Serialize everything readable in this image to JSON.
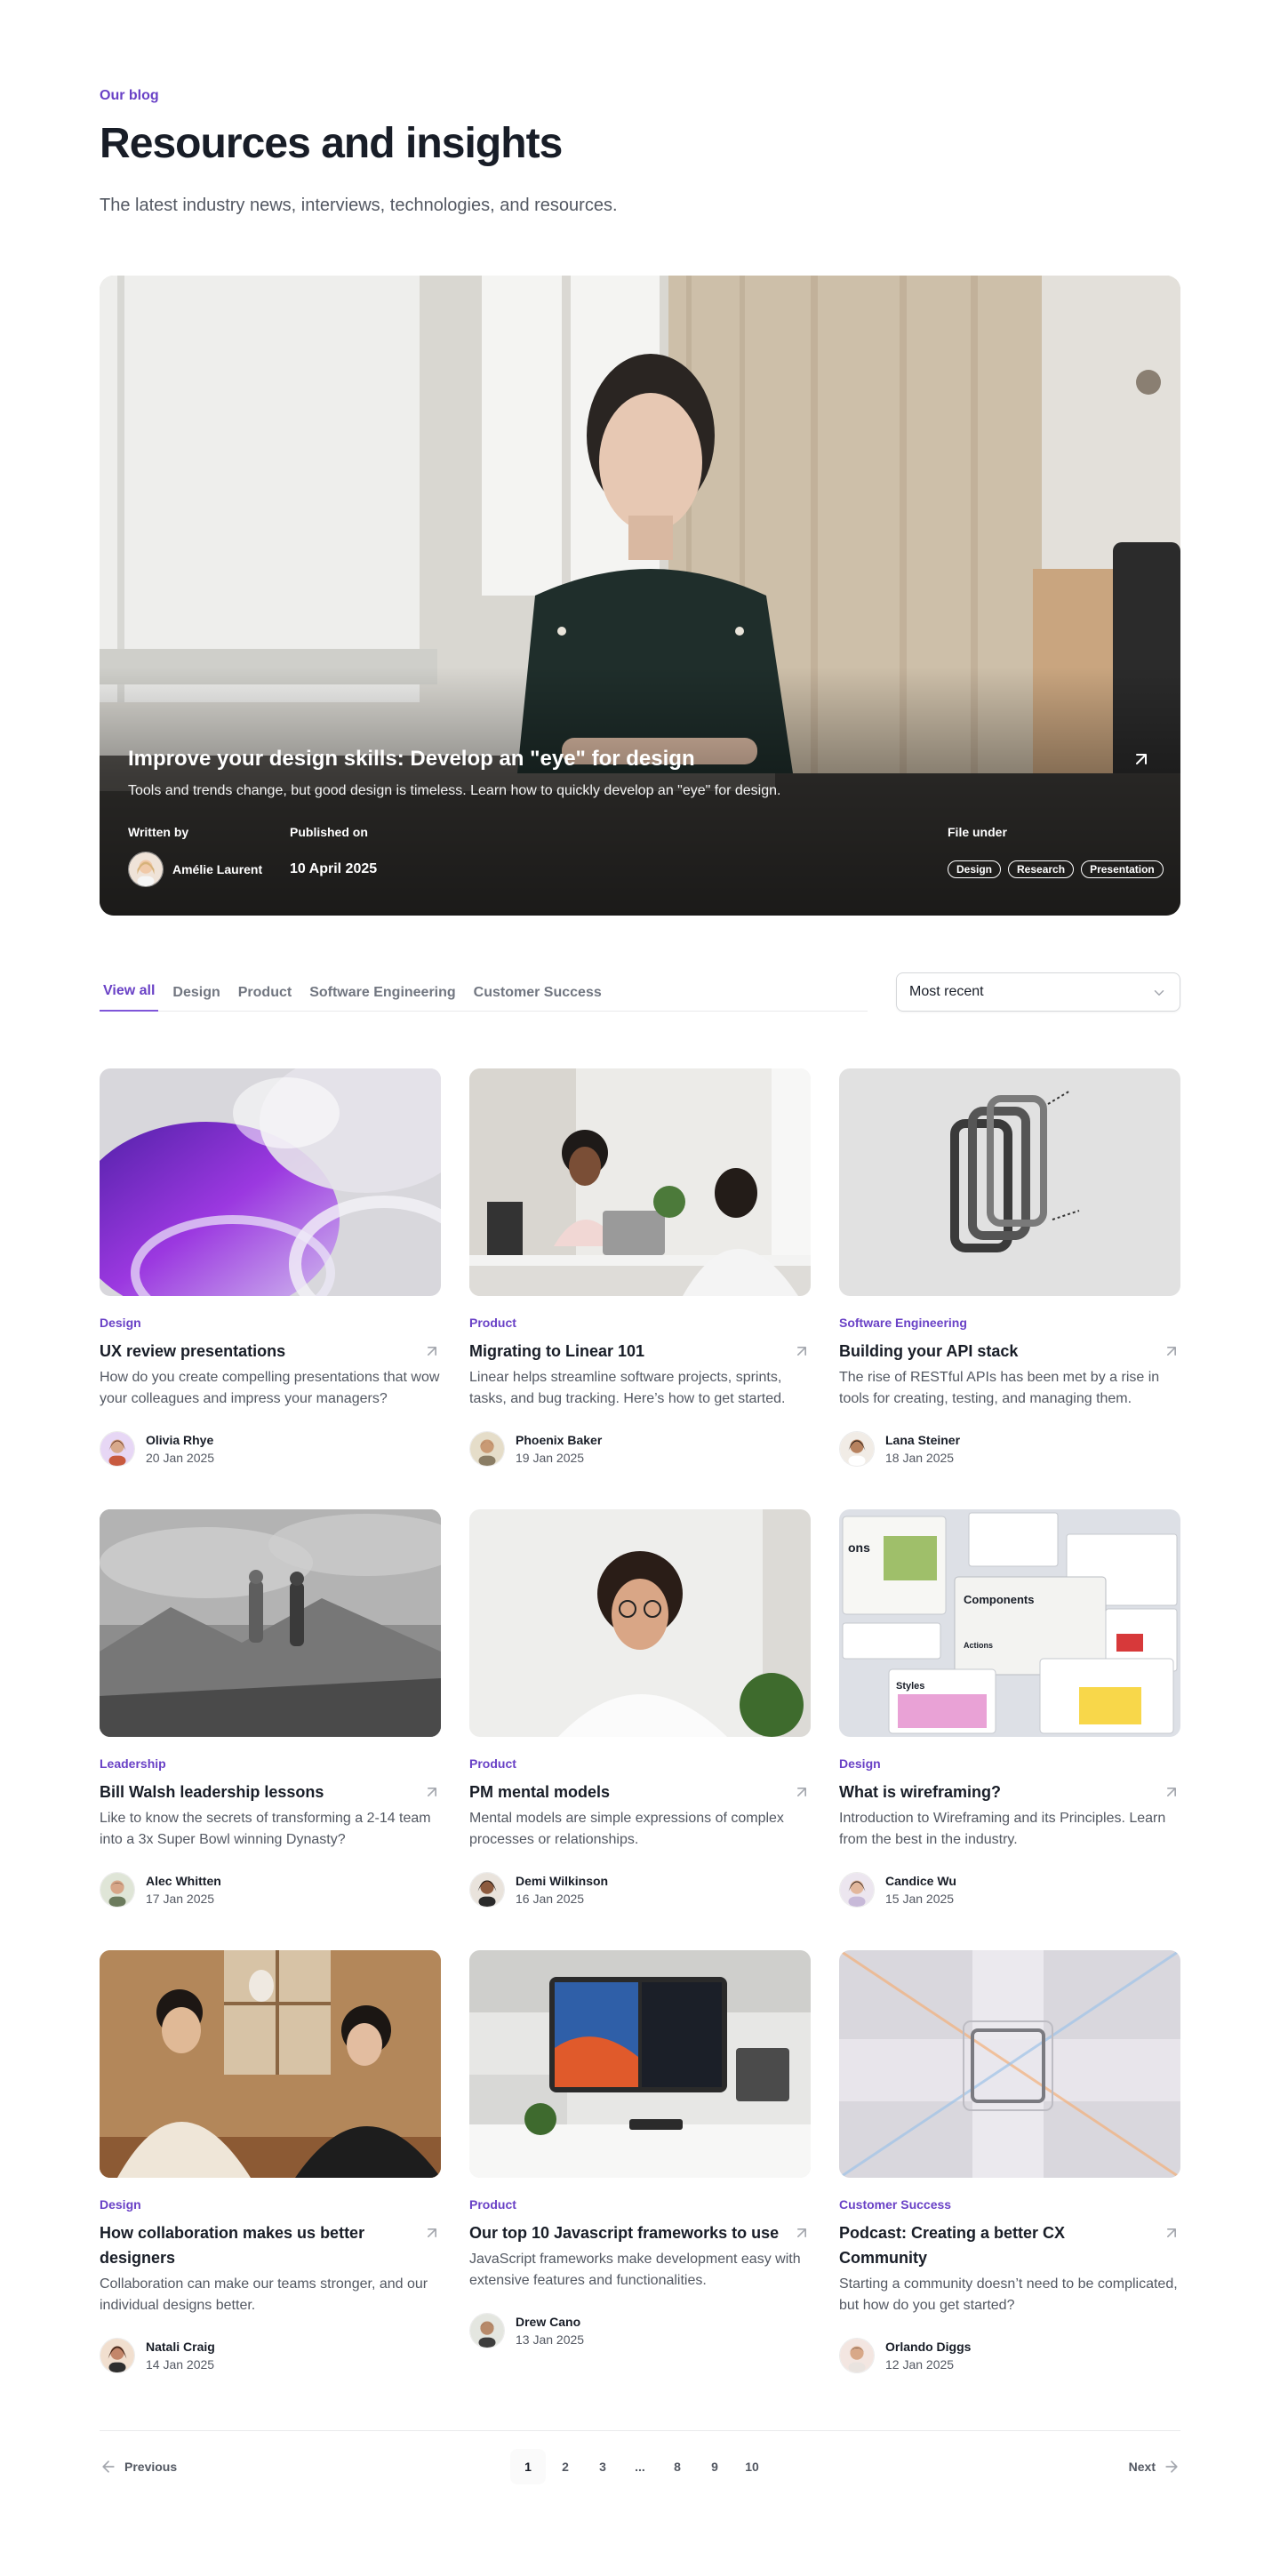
{
  "header": {
    "eyebrow": "Our blog",
    "title": "Resources and insights",
    "subtitle": "The latest industry news, interviews, technologies, and resources."
  },
  "featured": {
    "title": "Improve your design skills: Develop an \"eye\" for design",
    "description": "Tools and trends change, but good design is timeless. Learn how to quickly develop an \"eye\" for design.",
    "written_by_label": "Written by",
    "author": "Amélie Laurent",
    "published_label": "Published on",
    "date": "10 April 2025",
    "file_under_label": "File under",
    "tags": [
      "Design",
      "Research",
      "Presentation"
    ],
    "arrow_icon": "arrow-up-right-icon"
  },
  "filters": {
    "tabs": [
      "View all",
      "Design",
      "Product",
      "Software Engineering",
      "Customer Success"
    ],
    "active_tab": "View all",
    "sort_value": "Most recent"
  },
  "posts": [
    {
      "category": "Design",
      "title": "UX review presentations",
      "description": "How do you create compelling presentations that wow your colleagues and impress your managers?",
      "author": "Olivia Rhye",
      "date": "20 Jan 2025"
    },
    {
      "category": "Product",
      "title": "Migrating to Linear 101",
      "description": "Linear helps streamline software projects, sprints, tasks, and bug tracking. Here’s how to get started.",
      "author": "Phoenix Baker",
      "date": "19 Jan 2025"
    },
    {
      "category": "Software Engineering",
      "title": "Building your API stack",
      "description": "The rise of RESTful APIs has been met by a rise in tools for creating, testing, and managing them.",
      "author": "Lana Steiner",
      "date": "18 Jan 2025"
    },
    {
      "category": "Leadership",
      "title": "Bill Walsh leadership lessons",
      "description": "Like to know the secrets of transforming a 2-14 team into a 3x Super Bowl winning Dynasty?",
      "author": "Alec Whitten",
      "date": "17 Jan 2025"
    },
    {
      "category": "Product",
      "title": "PM mental models",
      "description": "Mental models are simple expressions of complex processes or relationships.",
      "author": "Demi Wilkinson",
      "date": "16 Jan 2025"
    },
    {
      "category": "Design",
      "title": "What is wireframing?",
      "description": "Introduction to Wireframing and its Principles. Learn from the best in the industry.",
      "author": "Candice Wu",
      "date": "15 Jan 2025"
    },
    {
      "category": "Design",
      "title": "How collaboration makes us better designers",
      "description": "Collaboration can make our teams stronger, and our individual designs better.",
      "author": "Natali Craig",
      "date": "14 Jan 2025"
    },
    {
      "category": "Product",
      "title": "Our top 10 Javascript frameworks to use",
      "description": "JavaScript frameworks make development easy with extensive features and functionalities.",
      "author": "Drew Cano",
      "date": "13 Jan 2025"
    },
    {
      "category": "Customer Success",
      "title": "Podcast: Creating a better CX Community",
      "description": "Starting a community doesn’t need to be complicated, but how do you get started?",
      "author": "Orlando Diggs",
      "date": "12 Jan 2025"
    }
  ],
  "thumb_text": {
    "wire_ons": "ons",
    "wire_components": "Components",
    "wire_actions": "Actions",
    "wire_styles": "Styles"
  },
  "pagination": {
    "previous": "Previous",
    "next": "Next",
    "pages": [
      "1",
      "2",
      "3",
      "...",
      "8",
      "9",
      "10"
    ],
    "current": "1"
  },
  "colors": {
    "brand": "#6941c6",
    "text": "#181d27",
    "muted": "#535862",
    "border": "#e9eaeb"
  }
}
